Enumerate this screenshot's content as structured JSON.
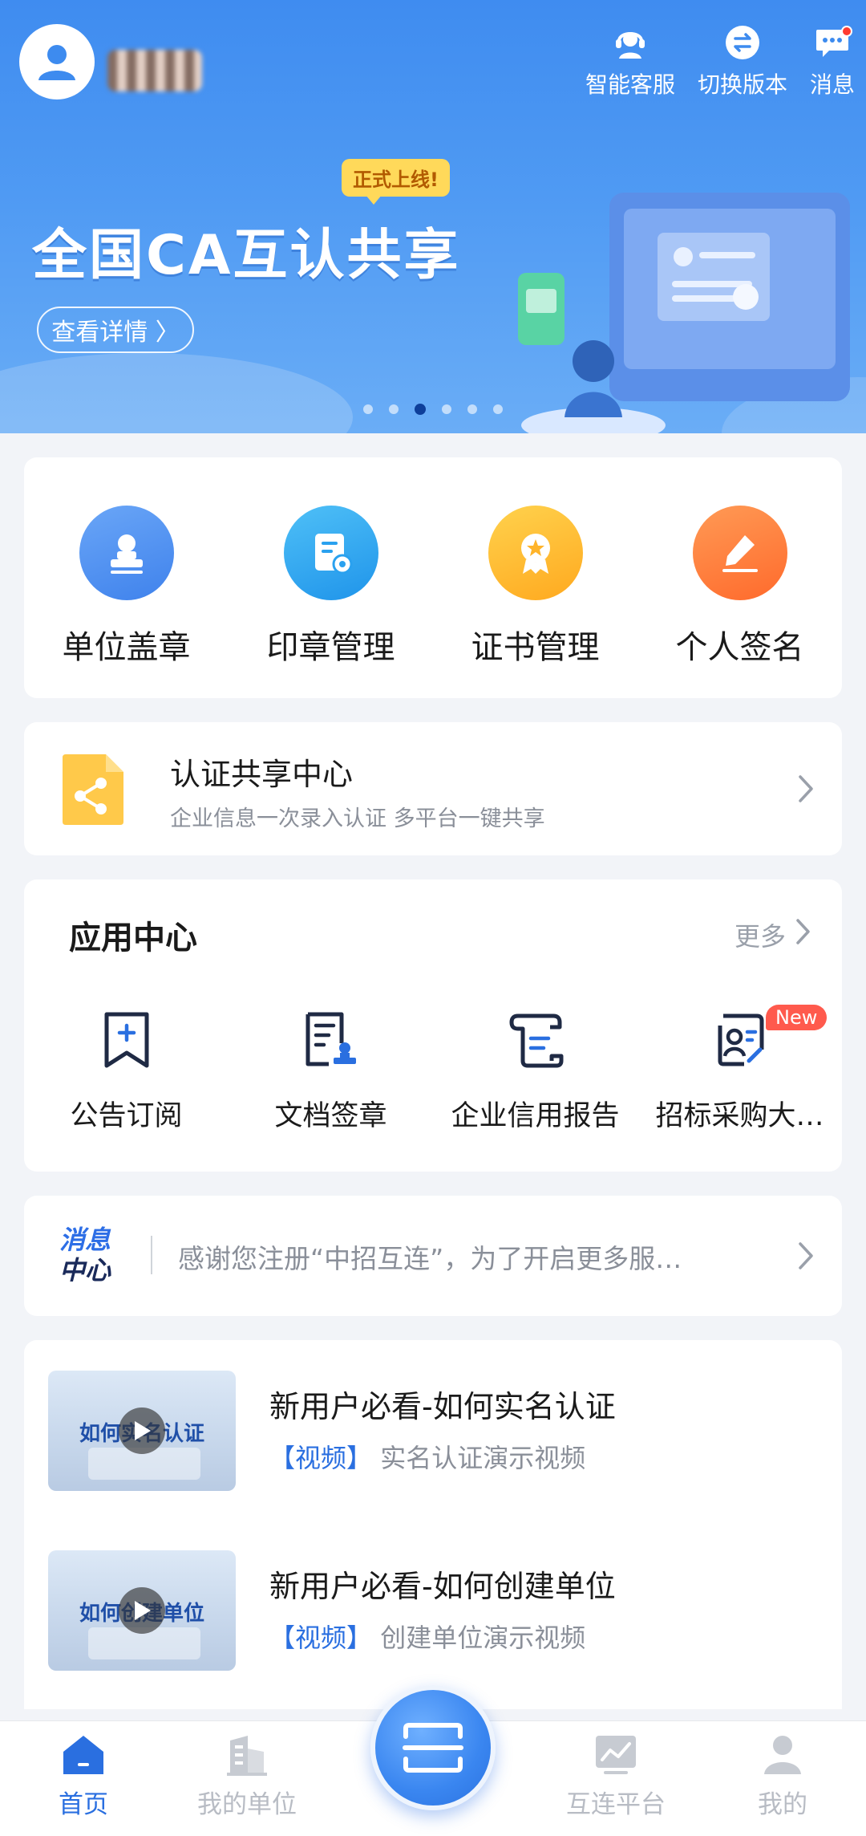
{
  "header": {
    "actions": [
      {
        "label": "智能客服",
        "icon": "headset-icon"
      },
      {
        "label": "切换版本",
        "icon": "switch-icon"
      },
      {
        "label": "消息",
        "icon": "message-icon",
        "has_dot": true
      }
    ]
  },
  "banner": {
    "tag": "正式上线!",
    "title": "全国CA互认共享",
    "button": "查看详情 〉",
    "slide_count": 6,
    "active_slide": 3
  },
  "quick_actions": [
    {
      "label": "单位盖章",
      "icon": "unit-stamp-icon",
      "color": "#4f8ff0"
    },
    {
      "label": "印章管理",
      "icon": "seal-management-icon",
      "color": "#2fa6f2"
    },
    {
      "label": "证书管理",
      "icon": "certificate-icon",
      "color": "#ffbe2e"
    },
    {
      "label": "个人签名",
      "icon": "signature-icon",
      "color": "#ff7b3a"
    }
  ],
  "share_center": {
    "title": "认证共享中心",
    "subtitle": "企业信息一次录入认证 多平台一键共享"
  },
  "app_center": {
    "title": "应用中心",
    "more": "更多",
    "apps": [
      {
        "label": "公告订阅",
        "icon": "bookmark-icon"
      },
      {
        "label": "文档签章",
        "icon": "document-seal-icon"
      },
      {
        "label": "企业信用报告",
        "icon": "scroll-report-icon"
      },
      {
        "label": "招标采购大…",
        "icon": "bid-profile-icon",
        "badge": "New"
      }
    ]
  },
  "message_center": {
    "logo_line1": "消息",
    "logo_line2": "中心",
    "text": "感谢您注册“中招互连”，为了开启更多服…"
  },
  "videos": [
    {
      "thumb_caption": "如何实名认证",
      "title": "新用户必看-如何实名认证",
      "tag": "【视频】",
      "desc": "实名认证演示视频"
    },
    {
      "thumb_caption": "如何创建单位",
      "title": "新用户必看-如何创建单位",
      "tag": "【视频】",
      "desc": "创建单位演示视频"
    }
  ],
  "tabbar": {
    "tabs": [
      {
        "label": "首页",
        "icon": "home-icon",
        "active": true
      },
      {
        "label": "我的单位",
        "icon": "building-icon",
        "active": false
      },
      {
        "label": "互连平台",
        "icon": "chart-icon",
        "active": false
      },
      {
        "label": "我的",
        "icon": "profile-icon",
        "active": false
      }
    ],
    "center_icon": "scan-icon"
  },
  "colors": {
    "primary": "#2a6fe0",
    "hero": "#4f9af3",
    "muted": "#8a8f99",
    "badge": "#ff5a4d"
  }
}
